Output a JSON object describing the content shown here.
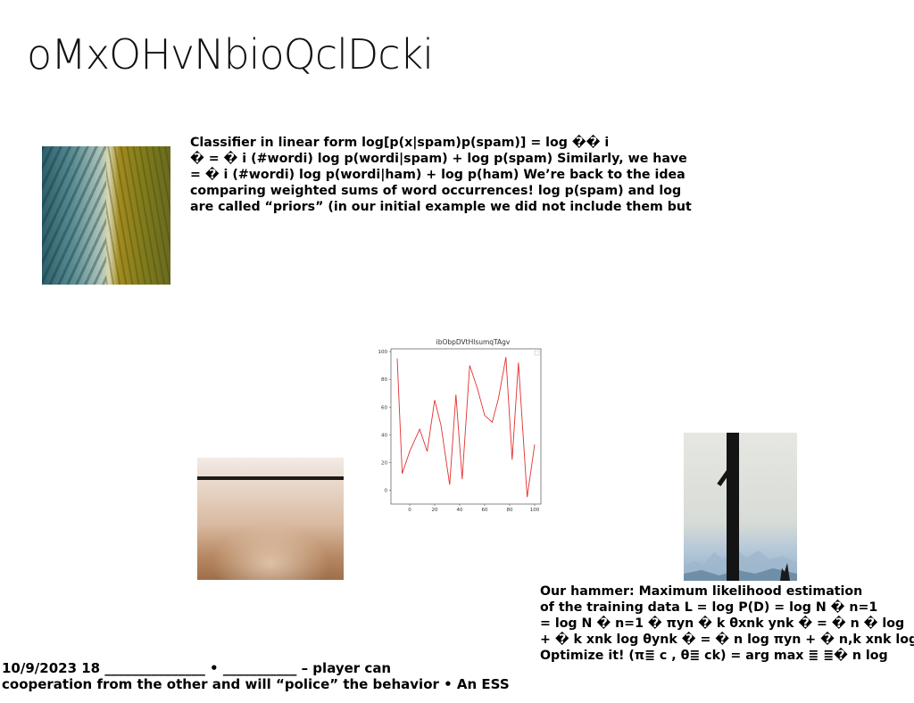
{
  "slide": {
    "title": "oMxOHvNbioQclDcki",
    "para_top": [
      "Classifier in linear form log[p(x|spam)p(spam)] = log �� i",
      "� = � i (#wordi) log p(wordi|spam) + log p(spam) Similarly, we have",
      "= � i (#wordi) log p(wordi|ham) + log p(ham) We’re back to the idea",
      "comparing weighted sums of word occurrences! log p(spam) and log",
      "are called “priors” (in our initial example we did not include them but"
    ],
    "para_right": [
      "Our hammer: Maximum likelihood estimation",
      "of the training data L = log P(D) = log N � n=1",
      "= log N � n=1 � πyn � k θxnk ynk � = � n � log",
      "+ � k xnk log θynk � = � n log πyn + � n,k xnk log",
      "Optimize it! (π≣ c , θ≣ ck) = arg max ≣ ≣� n log"
    ],
    "footer": [
      "10/9/2023 18 _______________ • ___________ – player can",
      "cooperation from the other  and will “police” the behavior • An ESS"
    ]
  },
  "colors": {
    "line": "#e03030",
    "axis": "#555555",
    "text": "#000000"
  },
  "chart_data": {
    "type": "line",
    "title": "ibObpDVtHlsumqTAgv",
    "x": [
      -10,
      -6,
      0,
      8,
      14,
      20,
      25,
      32,
      37,
      42,
      48,
      54,
      60,
      66,
      71,
      77,
      82,
      87,
      94,
      100
    ],
    "values": [
      95,
      12,
      28,
      44,
      28,
      65,
      47,
      4,
      69,
      8,
      90,
      74,
      54,
      49,
      66,
      96,
      22,
      92,
      -5,
      33
    ],
    "xlim": [
      -15,
      105
    ],
    "ylim": [
      -10,
      102
    ],
    "xticks": [
      0,
      20,
      40,
      60,
      80,
      100
    ],
    "yticks": [
      0,
      20,
      40,
      60,
      80,
      100
    ],
    "grid": false,
    "legend": "top-right"
  }
}
